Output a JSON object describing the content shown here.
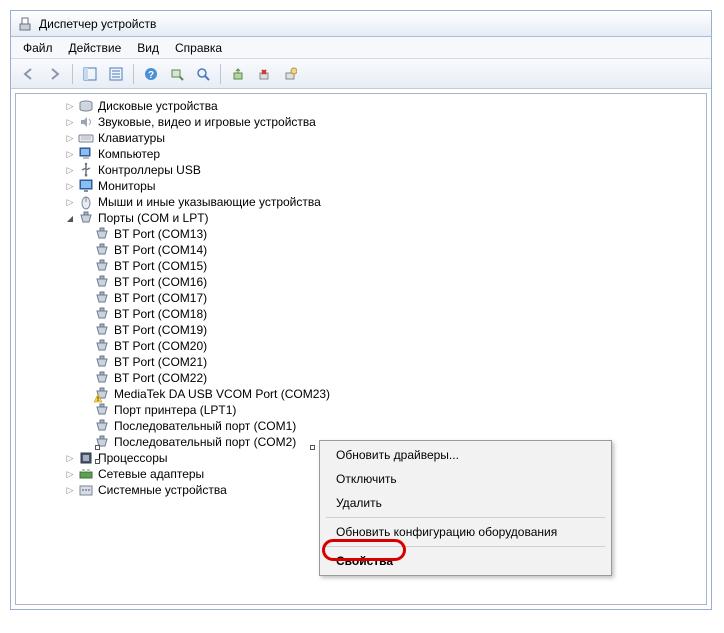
{
  "window": {
    "title": "Диспетчер устройств"
  },
  "menu": {
    "file": "Файл",
    "action": "Действие",
    "view": "Вид",
    "help": "Справка"
  },
  "tree": {
    "items": [
      {
        "label": "Дисковые устройства"
      },
      {
        "label": "Звуковые, видео и игровые устройства"
      },
      {
        "label": "Клавиатуры"
      },
      {
        "label": "Компьютер"
      },
      {
        "label": "Контроллеры USB"
      },
      {
        "label": "Мониторы"
      },
      {
        "label": "Мыши и иные указывающие устройства"
      }
    ],
    "ports_label": "Порты (COM и LPT)",
    "ports": [
      {
        "label": "BT Port (COM13)"
      },
      {
        "label": "BT Port (COM14)"
      },
      {
        "label": "BT Port (COM15)"
      },
      {
        "label": "BT Port (COM16)"
      },
      {
        "label": "BT Port (COM17)"
      },
      {
        "label": "BT Port (COM18)"
      },
      {
        "label": "BT Port (COM19)"
      },
      {
        "label": "BT Port (COM20)"
      },
      {
        "label": "BT Port (COM21)"
      },
      {
        "label": "BT Port (COM22)"
      },
      {
        "label": "MediaTek DA USB VCOM Port (COM23)",
        "warning": true
      },
      {
        "label": "Порт принтера (LPT1)"
      },
      {
        "label": "Последовательный порт (COM1)"
      },
      {
        "label": "Последовательный порт (COM2)"
      }
    ],
    "after": [
      {
        "label": "Процессоры"
      },
      {
        "label": "Сетевые адаптеры"
      },
      {
        "label": "Системные устройства"
      }
    ]
  },
  "context_menu": {
    "update_drivers": "Обновить драйверы...",
    "disable": "Отключить",
    "delete": "Удалить",
    "scan_hw": "Обновить конфигурацию оборудования",
    "properties": "Свойства"
  }
}
